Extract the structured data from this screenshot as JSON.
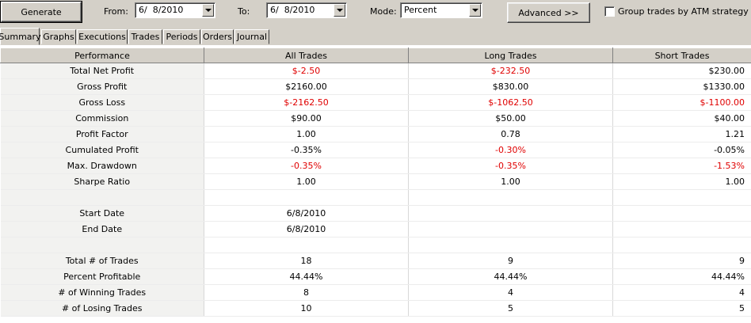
{
  "toolbar": {
    "generate_label": "Generate",
    "from_label": "From:",
    "from_value": "6/  8/2010",
    "to_label": "To:",
    "to_value": "6/  8/2010",
    "mode_label": "Mode:",
    "mode_value": "Percent",
    "advanced_label": "Advanced >>",
    "group_label": "Group trades by ATM strategy",
    "group_checked": false
  },
  "tabs": [
    {
      "label": "Summary",
      "active": true
    },
    {
      "label": "Graphs",
      "active": false
    },
    {
      "label": "Executions",
      "active": false
    },
    {
      "label": "Trades",
      "active": false
    },
    {
      "label": "Periods",
      "active": false
    },
    {
      "label": "Orders",
      "active": false
    },
    {
      "label": "Journal",
      "active": false
    }
  ],
  "table": {
    "headers": [
      "Performance",
      "All Trades",
      "Long Trades",
      "Short Trades"
    ],
    "rows": [
      {
        "cells": [
          "Total Net Profit",
          "$-2.50",
          "$-232.50",
          "$230.00"
        ],
        "negative": [
          false,
          true,
          true,
          false
        ]
      },
      {
        "cells": [
          "Gross Profit",
          "$2160.00",
          "$830.00",
          "$1330.00"
        ],
        "negative": [
          false,
          false,
          false,
          false
        ]
      },
      {
        "cells": [
          "Gross Loss",
          "$-2162.50",
          "$-1062.50",
          "$-1100.00"
        ],
        "negative": [
          false,
          true,
          true,
          true
        ]
      },
      {
        "cells": [
          "Commission",
          "$90.00",
          "$50.00",
          "$40.00"
        ],
        "negative": [
          false,
          false,
          false,
          false
        ]
      },
      {
        "cells": [
          "Profit Factor",
          "1.00",
          "0.78",
          "1.21"
        ],
        "negative": [
          false,
          false,
          false,
          false
        ]
      },
      {
        "cells": [
          "Cumulated Profit",
          "-0.35%",
          "-0.30%",
          "-0.05%"
        ],
        "negative": [
          false,
          false,
          true,
          false
        ]
      },
      {
        "cells": [
          "Max. Drawdown",
          "-0.35%",
          "-0.35%",
          "-1.53%"
        ],
        "negative": [
          false,
          true,
          true,
          true
        ]
      },
      {
        "cells": [
          "Sharpe Ratio",
          "1.00",
          "1.00",
          "1.00"
        ],
        "negative": [
          false,
          false,
          false,
          false
        ]
      },
      {
        "cells": [
          "",
          "",
          "",
          ""
        ],
        "negative": [
          false,
          false,
          false,
          false
        ]
      },
      {
        "cells": [
          "Start Date",
          "6/8/2010",
          "",
          ""
        ],
        "negative": [
          false,
          false,
          false,
          false
        ]
      },
      {
        "cells": [
          "End Date",
          "6/8/2010",
          "",
          ""
        ],
        "negative": [
          false,
          false,
          false,
          false
        ]
      },
      {
        "cells": [
          "",
          "",
          "",
          ""
        ],
        "negative": [
          false,
          false,
          false,
          false
        ]
      },
      {
        "cells": [
          "Total # of Trades",
          "18",
          "9",
          "9"
        ],
        "negative": [
          false,
          false,
          false,
          false
        ]
      },
      {
        "cells": [
          "Percent Profitable",
          "44.44%",
          "44.44%",
          "44.44%"
        ],
        "negative": [
          false,
          false,
          false,
          false
        ]
      },
      {
        "cells": [
          "# of Winning Trades",
          "8",
          "4",
          "4"
        ],
        "negative": [
          false,
          false,
          false,
          false
        ]
      },
      {
        "cells": [
          "# of Losing Trades",
          "10",
          "5",
          "5"
        ],
        "negative": [
          false,
          false,
          false,
          false
        ]
      }
    ]
  },
  "colors": {
    "negative": "#e00000",
    "window": "#d4d0c8"
  }
}
